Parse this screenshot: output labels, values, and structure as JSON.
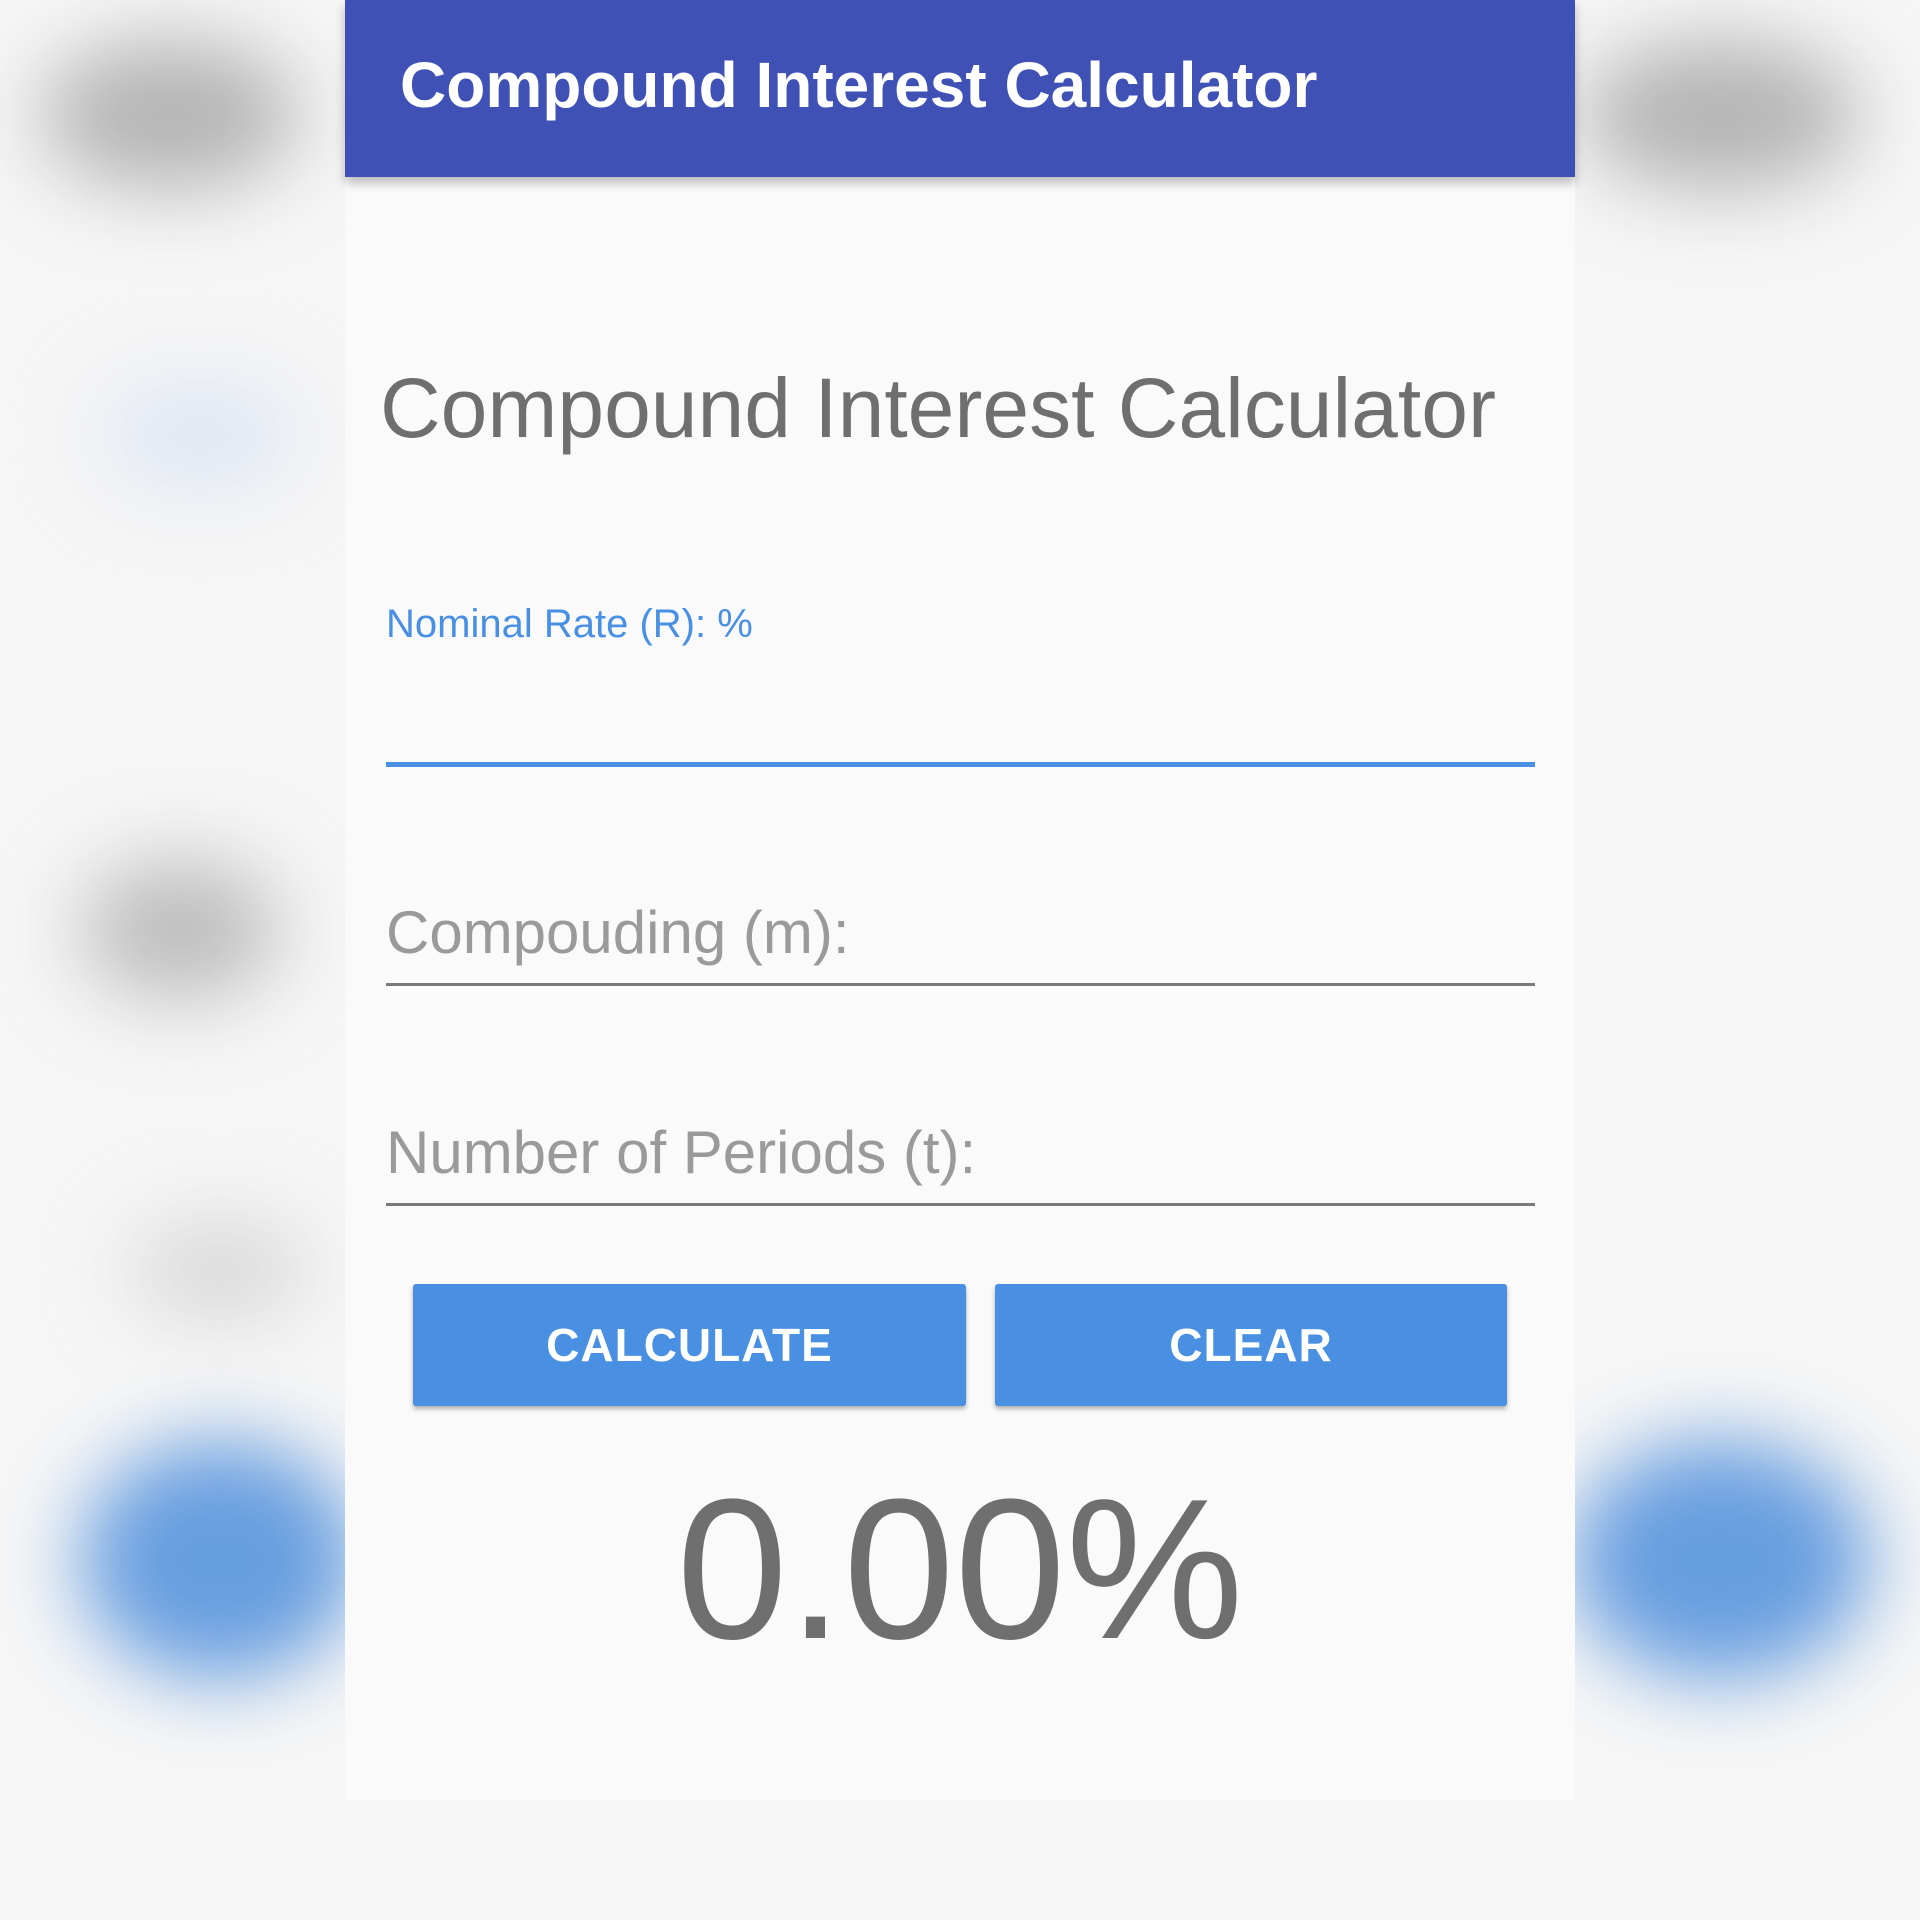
{
  "app": {
    "title": "Compound Interest Calculator"
  },
  "main": {
    "heading": "Compound Interest Calculator",
    "fields": {
      "rate": {
        "label": "Nominal Rate (R): %",
        "value": ""
      },
      "compounding": {
        "placeholder": "Compouding (m):",
        "value": ""
      },
      "periods": {
        "placeholder": "Number of Periods (t):",
        "value": ""
      }
    },
    "buttons": {
      "calculate": "CALCULATE",
      "clear": "CLEAR"
    },
    "result": "0.00%"
  },
  "colors": {
    "app_bar": "#3f51b5",
    "accent": "#4a90e2",
    "text_secondary": "#6f6f6f"
  }
}
